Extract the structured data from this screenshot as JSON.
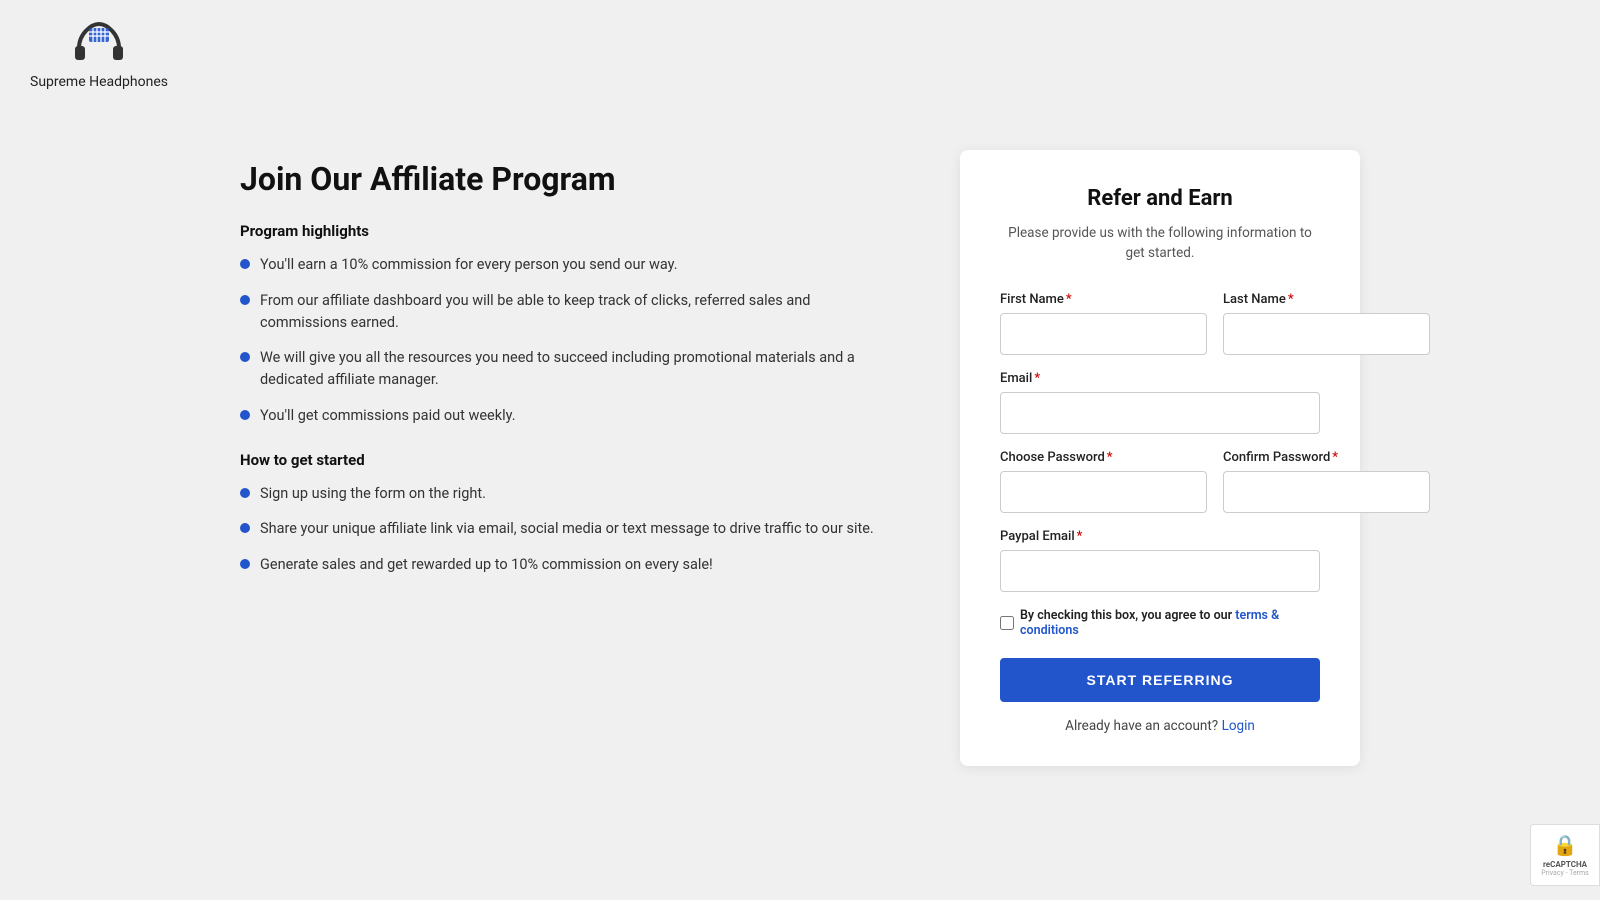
{
  "header": {
    "logo_text": "Supreme Headphones"
  },
  "left": {
    "page_title": "Join Our Affiliate Program",
    "highlights_heading": "Program highlights",
    "highlights": [
      "You'll earn a 10% commission for every person you send our way.",
      "From our affiliate dashboard you will be able to keep track of clicks, referred sales and commissions earned.",
      "We will give you all the resources you need to succeed including promotional materials and a dedicated affiliate manager.",
      "You'll get commissions paid out weekly."
    ],
    "how_to_heading": "How to get started",
    "how_to": [
      "Sign up using the form on the right.",
      "Share your unique affiliate link via email, social media or text message to drive traffic to our site.",
      "Generate sales and get rewarded up to 10% commission on every sale!"
    ]
  },
  "form": {
    "title": "Refer and Earn",
    "subtitle": "Please provide us with the following information to get started.",
    "first_name_label": "First Name",
    "last_name_label": "Last Name",
    "email_label": "Email",
    "choose_password_label": "Choose Password",
    "confirm_password_label": "Confirm Password",
    "paypal_email_label": "Paypal Email",
    "terms_text": "By checking this box, you agree to our",
    "terms_link_text": "terms & conditions",
    "submit_label": "START REFERRING",
    "login_text": "Already have an account?",
    "login_link_text": "Login"
  },
  "recaptcha": {
    "text": "reCAPTCHA",
    "subtext": "Privacy - Terms"
  }
}
